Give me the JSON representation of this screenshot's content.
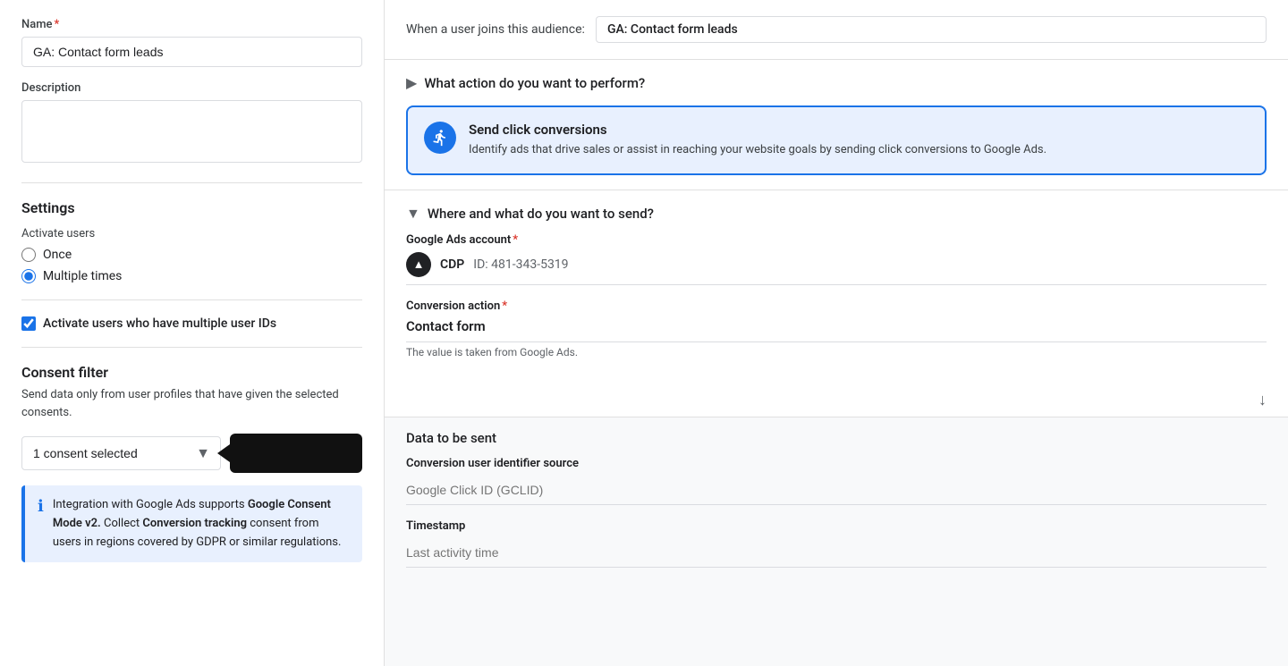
{
  "left": {
    "name_label": "Name",
    "name_required": true,
    "name_value": "GA: Contact form leads",
    "description_label": "Description",
    "description_placeholder": "",
    "settings_title": "Settings",
    "activate_users_label": "Activate users",
    "radio_options": [
      {
        "id": "once",
        "label": "Once",
        "checked": false
      },
      {
        "id": "multiple",
        "label": "Multiple times",
        "checked": true
      }
    ],
    "activate_multiple_ids_label": "Activate users who have multiple user IDs",
    "activate_multiple_ids_checked": true,
    "consent_filter_title": "Consent filter",
    "consent_filter_desc": "Send data only from user profiles that have given the selected consents.",
    "consent_select_value": "1 consent selected",
    "info_text_1": "Integration with Google Ads supports ",
    "info_bold_1": "Google Consent Mode v2.",
    "info_text_2": " Collect ",
    "info_bold_2": "Conversion tracking",
    "info_text_3": " consent from users in regions covered by GDPR or similar regulations."
  },
  "right": {
    "audience_join_label": "When a user joins this audience:",
    "audience_join_value": "GA: Contact form leads",
    "action_section": {
      "header": "What action do you want to perform?",
      "header_icon": "chevron-right",
      "card_title": "Send click conversions",
      "card_desc": "Identify ads that drive sales or assist in reaching your website goals by sending click conversions to Google Ads."
    },
    "where_section": {
      "header": "Where and what do you want to send?",
      "header_icon": "chevron-down",
      "google_ads_label": "Google Ads account",
      "google_ads_required": true,
      "ads_account_name": "CDP",
      "ads_account_id": "ID: 481-343-5319",
      "conversion_action_label": "Conversion action",
      "conversion_action_required": true,
      "conversion_action_value": "Contact form",
      "conversion_action_hint": "The value is taken from Google Ads."
    },
    "data_sent_section": {
      "header": "Data to be sent",
      "conversion_user_id_label": "Conversion user identifier source",
      "conversion_user_id_placeholder": "Google Click ID (GCLID)",
      "timestamp_label": "Timestamp",
      "timestamp_placeholder": "Last activity time"
    }
  }
}
